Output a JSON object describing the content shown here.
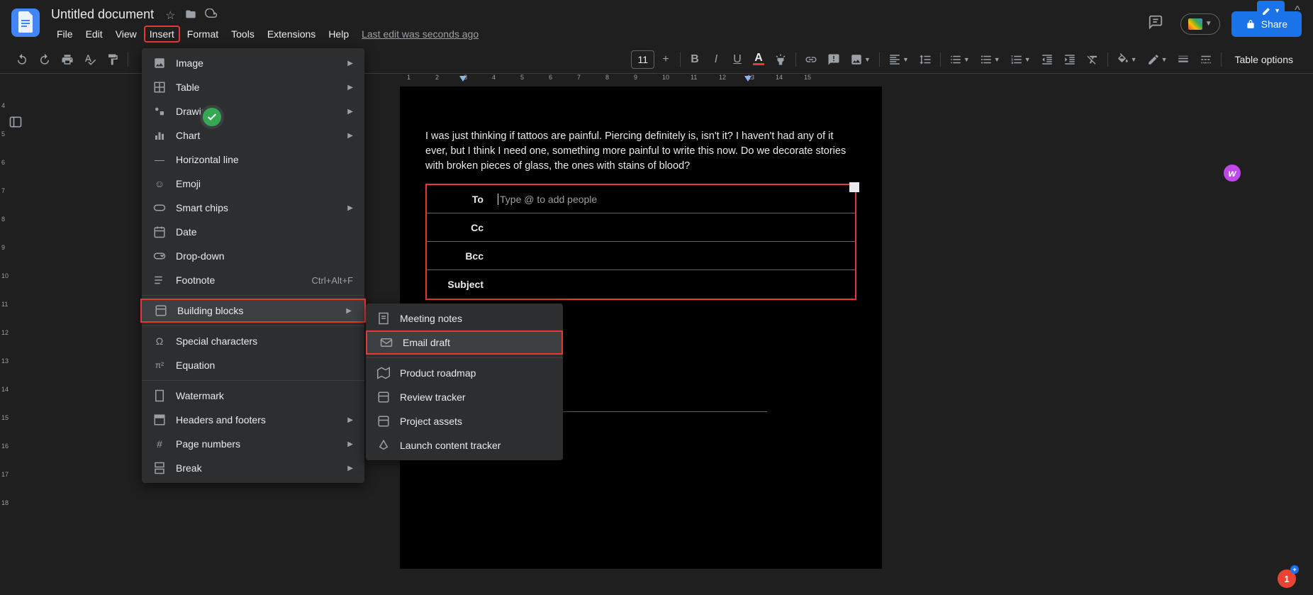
{
  "doc": {
    "title": "Untitled document",
    "last_edit": "Last edit was seconds ago"
  },
  "menubar": [
    "File",
    "Edit",
    "View",
    "Insert",
    "Format",
    "Tools",
    "Extensions",
    "Help"
  ],
  "menubar_highlighted_index": 3,
  "share_label": "Share",
  "toolbar": {
    "font_size": "11",
    "table_options": "Table options"
  },
  "ruler_h": [
    "1",
    "2",
    "3",
    "4",
    "5",
    "6",
    "7",
    "8",
    "9",
    "10",
    "11",
    "12",
    "13",
    "14",
    "15"
  ],
  "ruler_v": [
    "4",
    "5",
    "6",
    "7",
    "8",
    "9",
    "10",
    "11",
    "12",
    "13",
    "14",
    "15",
    "16",
    "17",
    "18"
  ],
  "body_text": "I was just thinking if tattoos are painful. Piercing definitely is, isn't it? I haven't had any of it ever, but I think I need one, something more painful to write this now. Do we decorate stories with broken pieces of glass, the ones with stains of blood?",
  "email_draft": {
    "labels": {
      "to": "To",
      "cc": "Cc",
      "bcc": "Bcc",
      "subject": "Subject"
    },
    "to_placeholder": "Type @ to add people"
  },
  "insert_menu": {
    "items": [
      {
        "icon": "image",
        "label": "Image",
        "sub": true
      },
      {
        "icon": "table",
        "label": "Table",
        "sub": true
      },
      {
        "icon": "drawing",
        "label": "Drawing",
        "sub": true
      },
      {
        "icon": "chart",
        "label": "Chart",
        "sub": true
      },
      {
        "icon": "hr",
        "label": "Horizontal line"
      },
      {
        "icon": "emoji",
        "label": "Emoji"
      },
      {
        "icon": "smartchips",
        "label": "Smart chips",
        "sub": true
      },
      {
        "icon": "date",
        "label": "Date"
      },
      {
        "icon": "dropdown",
        "label": "Drop-down"
      },
      {
        "icon": "footnote",
        "label": "Footnote",
        "shortcut": "Ctrl+Alt+F"
      }
    ],
    "building_blocks_label": "Building blocks",
    "items2": [
      {
        "icon": "specialchars",
        "label": "Special characters"
      },
      {
        "icon": "equation",
        "label": "Equation"
      }
    ],
    "items3": [
      {
        "icon": "watermark",
        "label": "Watermark"
      },
      {
        "icon": "headersfooters",
        "label": "Headers and footers",
        "sub": true
      },
      {
        "icon": "pagenumbers",
        "label": "Page numbers",
        "sub": true
      },
      {
        "icon": "break",
        "label": "Break",
        "sub": true
      }
    ]
  },
  "building_blocks_submenu": {
    "group1": [
      {
        "icon": "notes",
        "label": "Meeting notes"
      },
      {
        "icon": "email",
        "label": "Email draft",
        "highlighted": true
      }
    ],
    "group2": [
      {
        "icon": "roadmap",
        "label": "Product roadmap"
      },
      {
        "icon": "review",
        "label": "Review tracker"
      },
      {
        "icon": "assets",
        "label": "Project assets"
      },
      {
        "icon": "launch",
        "label": "Launch content tracker"
      }
    ]
  },
  "user_badge": "w",
  "notif_count": "1"
}
